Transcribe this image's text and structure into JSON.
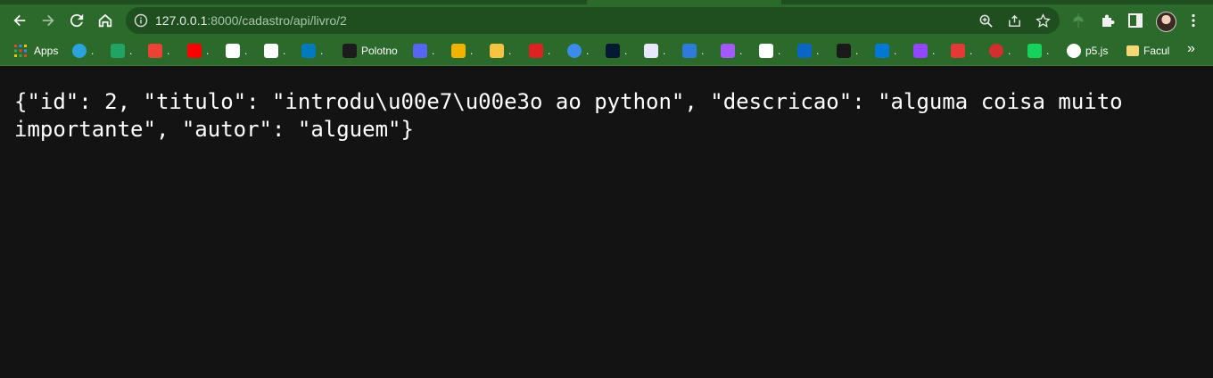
{
  "browser": {
    "url": {
      "host": "127.0.0.1",
      "path": ":8000/cadastro/api/livro/2"
    },
    "icons": {
      "back": "arrow-left-icon",
      "forward": "arrow-right-icon",
      "reload": "reload-icon",
      "home": "home-icon",
      "site_info": "info-icon",
      "zoom": "zoom-icon",
      "share": "share-icon",
      "bookmark_star": "star-icon",
      "extension_pin": "leaf-icon",
      "extensions": "puzzle-icon",
      "side_panel": "side-panel-icon",
      "menu": "kebab-menu-icon"
    },
    "theme": {
      "frame": "#2b6a2b",
      "frame_dark": "#1f4f1f",
      "page_bg": "#131313"
    }
  },
  "bookmarks": {
    "apps_label": "Apps",
    "items": [
      {
        "icon": "telegram-icon",
        "label": ".",
        "color": "#2aa3df"
      },
      {
        "icon": "google-drive-icon",
        "label": ".",
        "color": "#1fa463"
      },
      {
        "icon": "gmail-icon",
        "label": ".",
        "color": "#ea4335"
      },
      {
        "icon": "youtube-icon",
        "label": ".",
        "color": "#ff0000"
      },
      {
        "icon": "google-icon",
        "label": ".",
        "color": "#ffffff"
      },
      {
        "icon": "github-icon",
        "label": ".",
        "color": "#ffffff"
      },
      {
        "icon": "trello-icon",
        "label": ".",
        "color": "#0079bf"
      },
      {
        "icon": "polotno-icon",
        "label": "Polotno",
        "color": "#1c1c1c"
      },
      {
        "icon": "discord-icon",
        "label": ".",
        "color": "#5865f2"
      },
      {
        "icon": "star-bookmark-icon",
        "label": ".",
        "color": "#f0b400"
      },
      {
        "icon": "shortcut-icon",
        "label": ".",
        "color": "#f6c343"
      },
      {
        "icon": "scratch-icon",
        "label": ".",
        "color": "#d22"
      },
      {
        "icon": "drop-icon",
        "label": ".",
        "color": "#3b8beb"
      },
      {
        "icon": "alura-icon",
        "label": ".",
        "color": "#051933"
      },
      {
        "icon": "alura-light-icon",
        "label": ".",
        "color": "#e8e8ff"
      },
      {
        "icon": "alura-blue-icon",
        "label": ".",
        "color": "#2f7bdc"
      },
      {
        "icon": "figma-icon",
        "label": ".",
        "color": "#a259ff"
      },
      {
        "icon": "notion-icon",
        "label": ".",
        "color": "#ffffff"
      },
      {
        "icon": "linkedin-icon",
        "label": ".",
        "color": "#0a66c2"
      },
      {
        "icon": "k-icon",
        "label": ".",
        "color": "#1a1a1a"
      },
      {
        "icon": "outlook-icon",
        "label": ".",
        "color": "#0078d4"
      },
      {
        "icon": "twitch-icon",
        "label": ".",
        "color": "#9146ff"
      },
      {
        "icon": "heart-icon",
        "label": ".",
        "color": "#e53935"
      },
      {
        "icon": "globe-red-icon",
        "label": ".",
        "color": "#d32f2f"
      },
      {
        "icon": "p-green-icon",
        "label": ".",
        "color": "#17d15d"
      },
      {
        "icon": "p5js-icon",
        "label": "p5.js",
        "color": "#ffffff"
      },
      {
        "icon": "folder-icon",
        "label": "Facul",
        "color": "#f8d775"
      }
    ],
    "overflow_label": "»"
  },
  "page": {
    "json_text": "{\"id\": 2, \"titulo\": \"introdu\\u00e7\\u00e3o ao python\", \"descricao\": \"alguma coisa muito importante\", \"autor\": \"alguem\"}"
  }
}
